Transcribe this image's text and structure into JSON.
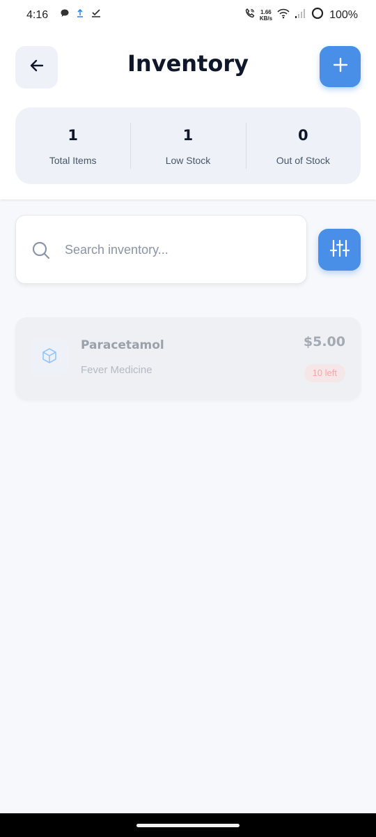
{
  "status_bar": {
    "time": "4:16",
    "speed_value": "1.66",
    "speed_unit": "KB/s",
    "battery": "100%",
    "left_icons": [
      "chat-bubble-icon",
      "upload-icon",
      "check-icon"
    ],
    "right_icons": [
      "call-icon",
      "wifi-icon",
      "signal-icon",
      "battery-ring-icon"
    ]
  },
  "header": {
    "title": "Inventory",
    "back_icon": "arrow-left-icon",
    "add_icon": "plus-icon"
  },
  "stats": [
    {
      "value": "1",
      "label": "Total Items"
    },
    {
      "value": "1",
      "label": "Low Stock"
    },
    {
      "value": "0",
      "label": "Out of Stock"
    }
  ],
  "search": {
    "placeholder": "Search inventory...",
    "value": ""
  },
  "filter": {
    "icon": "sliders-icon"
  },
  "items": [
    {
      "name": "Paracetamol",
      "category": "Fever Medicine",
      "price": "$5.00",
      "stock": "10 left",
      "icon": "box-icon"
    }
  ],
  "colors": {
    "accent": "#4a8fe7",
    "background": "#f6f8fb",
    "stat_panel": "#eef2f8",
    "low_stock_badge": "#f5e7e7"
  }
}
